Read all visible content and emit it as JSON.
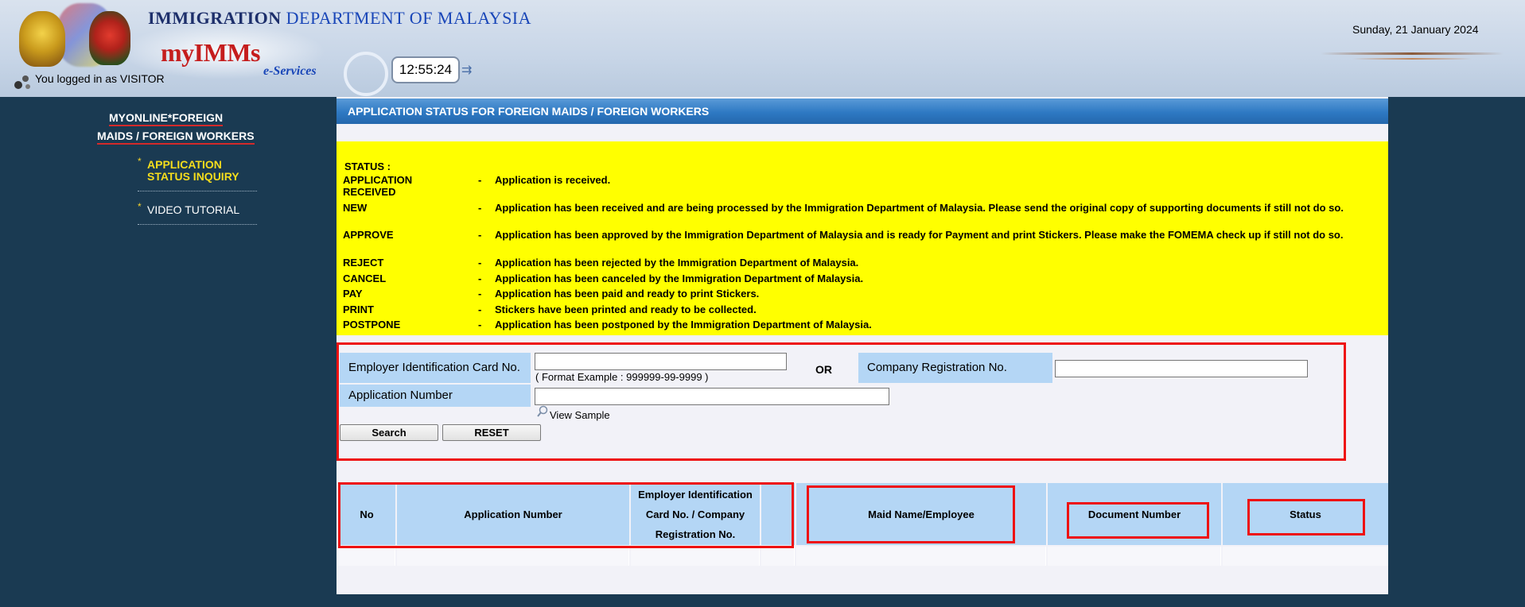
{
  "header": {
    "dept_title_bold": "IMMIGRATION",
    "dept_title_rest": "DEPARTMENT OF MALAYSIA",
    "app_name": "myIMMs",
    "app_sub": "e-Services",
    "clock": "12:55:24",
    "login_status": "You logged in as VISITOR",
    "date": "Sunday, 21 January 2024"
  },
  "sidebar": {
    "title_line1": "MYONLINE*FOREIGN",
    "title_line2": "MAIDS / FOREIGN WORKERS",
    "items": [
      {
        "label": "APPLICATION STATUS INQUIRY",
        "active": true
      },
      {
        "label": "VIDEO TUTORIAL",
        "active": false
      }
    ]
  },
  "main": {
    "title": "APPLICATION STATUS FOR FOREIGN MAIDS / FOREIGN WORKERS",
    "status_heading": "STATUS :",
    "statuses": [
      {
        "code": "APPLICATION RECEIVED",
        "desc": "Application is received."
      },
      {
        "code": "NEW",
        "desc": "Application has been received and are being processed by the Immigration Department of Malaysia. Please send the original copy of supporting documents if still not do so."
      },
      {
        "code": "APPROVE",
        "desc": "Application has been approved by the Immigration Department of Malaysia and is ready for Payment and print Stickers. Please make the FOMEMA check up if still not do so."
      },
      {
        "code": "REJECT",
        "desc": "Application has been rejected by the Immigration Department of Malaysia."
      },
      {
        "code": "CANCEL",
        "desc": "Application has been canceled by the Immigration Department of Malaysia."
      },
      {
        "code": "PAY",
        "desc": "Application has been paid and ready to print Stickers."
      },
      {
        "code": "PRINT",
        "desc": "Stickers have been printed and ready to be collected."
      },
      {
        "code": "POSTPONE",
        "desc": "Application has been postponed by the Immigration Department of Malaysia."
      }
    ],
    "status_dash": "-"
  },
  "search": {
    "employer_label": "Employer Identification Card No.",
    "employer_value": "",
    "format_example": "( Format Example : 999999-99-9999 )",
    "or_label": "OR",
    "company_label": "Company Registration No.",
    "company_value": "",
    "appno_label": "Application Number",
    "appno_value": "",
    "view_sample": "View Sample",
    "search_button": "Search",
    "reset_button": "RESET"
  },
  "results": {
    "headers": {
      "no": "No",
      "appno": "Application Number",
      "employer": "Employer Identification Card No. / Company Registration No.",
      "maid": "Maid Name/Employee",
      "docno": "Document Number",
      "status": "Status"
    },
    "rows": []
  },
  "colors": {
    "page_bg": "#1a3a52",
    "header_bar": "#2e79c3",
    "status_box": "#ffff00",
    "label_cell": "#b4d6f5",
    "annotation": "#ee1111",
    "sidebar_active": "#f6dd1c"
  }
}
